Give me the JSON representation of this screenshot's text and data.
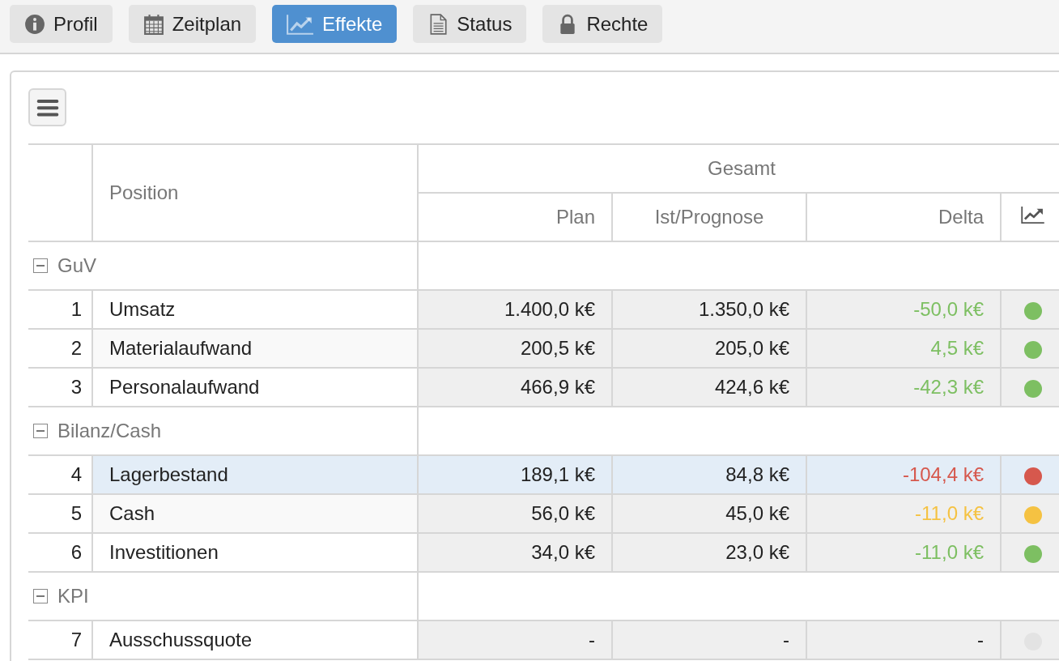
{
  "tabs": [
    {
      "label": "Profil",
      "selected": false
    },
    {
      "label": "Zeitplan",
      "selected": false
    },
    {
      "label": "Effekte",
      "selected": true
    },
    {
      "label": "Status",
      "selected": false
    },
    {
      "label": "Rechte",
      "selected": false
    }
  ],
  "table": {
    "columns": {
      "position": "Position",
      "group": "Gesamt",
      "plan": "Plan",
      "actual": "Ist/Prognose",
      "delta": "Delta"
    },
    "groups": [
      {
        "name": "GuV",
        "expanded": true,
        "rows": [
          {
            "number": "1",
            "position": "Umsatz",
            "plan": "1.400,0 k€",
            "actual": "1.350,0 k€",
            "delta": "-50,0 k€",
            "rated": true,
            "color": "#7dbf62",
            "selected": false
          },
          {
            "number": "2",
            "position": "Materialaufwand",
            "plan": "200,5 k€",
            "actual": "205,0 k€",
            "delta": "4,5 k€",
            "rated": true,
            "color": "#7dbf62",
            "selected": false
          },
          {
            "number": "3",
            "position": "Personalaufwand",
            "plan": "466,9 k€",
            "actual": "424,6 k€",
            "delta": "-42,3 k€",
            "rated": true,
            "color": "#7dbf62",
            "selected": false
          }
        ]
      },
      {
        "name": "Bilanz/Cash",
        "expanded": true,
        "rows": [
          {
            "number": "4",
            "position": "Lagerbestand",
            "plan": "189,1 k€",
            "actual": "84,8 k€",
            "delta": "-104,4 k€",
            "rated": true,
            "color": "#d6584d",
            "selected": true
          },
          {
            "number": "5",
            "position": "Cash",
            "plan": "56,0 k€",
            "actual": "45,0 k€",
            "delta": "-11,0 k€",
            "rated": true,
            "color": "#f5c242",
            "selected": false
          },
          {
            "number": "6",
            "position": "Investitionen",
            "plan": "34,0 k€",
            "actual": "23,0 k€",
            "delta": "-11,0 k€",
            "rated": true,
            "color": "#7dbf62",
            "selected": false
          }
        ]
      },
      {
        "name": "KPI",
        "expanded": true,
        "rows": [
          {
            "number": "7",
            "position": "Ausschussquote",
            "plan": "-",
            "actual": "-",
            "delta": "-",
            "rated": false,
            "color": "#e3e3e3",
            "selected": false
          }
        ]
      }
    ]
  }
}
